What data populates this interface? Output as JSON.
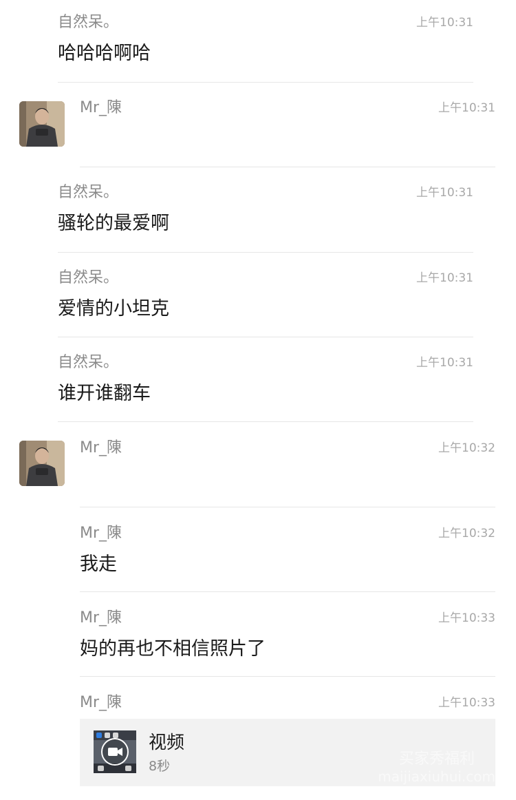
{
  "messages": [
    {
      "sender": "自然呆。",
      "time": "上午10:31",
      "text": "哈哈哈啊哈"
    },
    {
      "sender": "Mr_陳",
      "time": "上午10:31",
      "text": ""
    },
    {
      "sender": "自然呆。",
      "time": "上午10:31",
      "text": "骚轮的最爱啊"
    },
    {
      "sender": "自然呆。",
      "time": "上午10:31",
      "text": "爱情的小坦克"
    },
    {
      "sender": "自然呆。",
      "time": "上午10:31",
      "text": "谁开谁翻车"
    },
    {
      "sender": "Mr_陳",
      "time": "上午10:32",
      "text": ""
    },
    {
      "sender": "Mr_陳",
      "time": "上午10:32",
      "text": "我走"
    },
    {
      "sender": "Mr_陳",
      "time": "上午10:33",
      "text": "妈的再也不相信照片了"
    },
    {
      "sender": "Mr_陳",
      "time": "上午10:33",
      "text": ""
    }
  ],
  "video": {
    "title": "视频",
    "duration": "8秒",
    "icon": "video-camera-icon"
  },
  "watermark": {
    "line1": "买家秀福利",
    "line2": "maijiaxiuhui.com"
  },
  "colors": {
    "sender": "#8a8a8a",
    "time": "#a8a8a8",
    "text": "#1a1a1a",
    "divider": "#e6e6e6",
    "card": "#f2f2f2"
  }
}
